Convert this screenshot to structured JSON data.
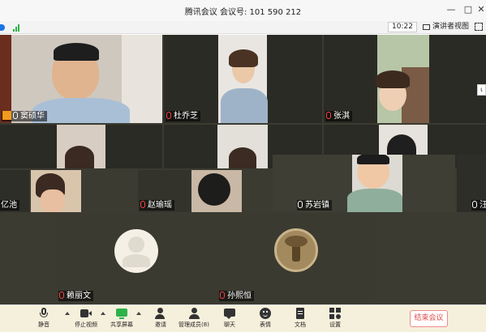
{
  "window": {
    "title": "腾讯会议  会议号: 101 590 212",
    "minimize_glyph": "—",
    "maximize_glyph": "□",
    "close_glyph": "✕"
  },
  "statusbar": {
    "clock": "10:22",
    "speaker_view_label": "演讲者视图",
    "side_handle_glyph": "ι"
  },
  "participants": [
    {
      "id": "p1",
      "name": "窦硕华",
      "host": true,
      "mic": "on"
    },
    {
      "id": "p2",
      "name": "杜乔芝",
      "host": false,
      "mic": "off"
    },
    {
      "id": "p3",
      "name": "张淇",
      "host": false,
      "mic": "off"
    },
    {
      "id": "p4",
      "name": "亿池",
      "host": false,
      "mic": "none"
    },
    {
      "id": "p5",
      "name": "赵瑜瑶",
      "host": false,
      "mic": "off"
    },
    {
      "id": "p6",
      "name": "苏岩镇",
      "host": false,
      "mic": "on"
    },
    {
      "id": "p7",
      "name": "汪",
      "host": false,
      "mic": "on"
    },
    {
      "id": "p8",
      "name": "赖丽文",
      "host": false,
      "mic": "off"
    },
    {
      "id": "p9",
      "name": "孙熙恒",
      "host": false,
      "mic": "off"
    }
  ],
  "toolbar": {
    "items": [
      {
        "label": "静音",
        "icon": "microphone-icon"
      },
      {
        "label": "停止视频",
        "icon": "video-camera-icon"
      },
      {
        "label": "共享屏幕",
        "icon": "share-screen-icon"
      },
      {
        "label": "邀请",
        "icon": "invite-icon"
      },
      {
        "label": "管理成员(8)",
        "icon": "members-icon"
      },
      {
        "label": "聊天",
        "icon": "chat-icon"
      },
      {
        "label": "表情",
        "icon": "emoji-icon"
      },
      {
        "label": "文档",
        "icon": "document-icon"
      },
      {
        "label": "设置",
        "icon": "settings-icon"
      }
    ],
    "end_meeting_label": "结束会议"
  },
  "colors": {
    "toolbar_bg": "#f5f0dc",
    "end_meeting": "#e04a4a",
    "host_badge": "#f39a1e",
    "share_icon": "#2db24a"
  }
}
